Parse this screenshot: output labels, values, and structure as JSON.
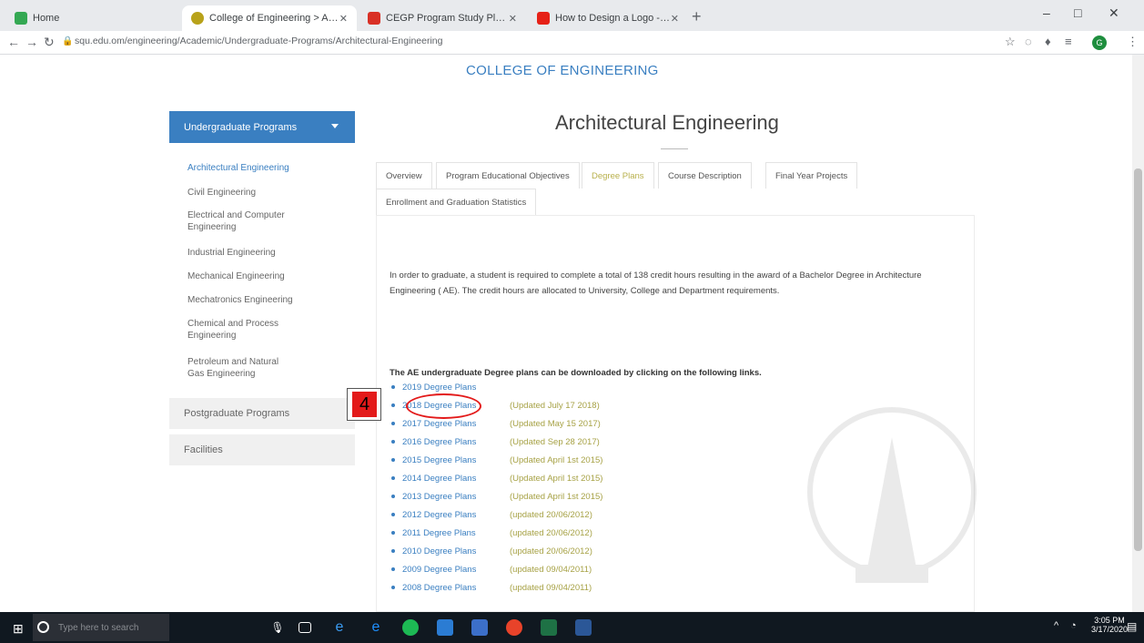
{
  "browser": {
    "tabs": [
      {
        "label": "Home",
        "color": "#34a853"
      },
      {
        "label": "College of Engineering > Academ",
        "color": "#b8a21a"
      },
      {
        "label": "CEGP Program Study Plans - ...",
        "color": "#d93025"
      },
      {
        "label": "How to Design a Logo - Full",
        "color": "#e62117"
      }
    ],
    "url": "squ.edu.om/engineering/Academic/Undergraduate-Programs/Architectural-Engineering",
    "new_tab": "+",
    "min": "–",
    "max": "□",
    "close": "✕"
  },
  "page": {
    "college": "COLLEGE OF ENGINEERING",
    "title": "Architectural Engineering"
  },
  "sidebar": {
    "header": "Undergraduate Programs",
    "items": [
      "Architectural Engineering",
      "Civil Engineering",
      "Electrical and Computer Engineering",
      "Industrial Engineering",
      "Mechanical Engineering",
      "Mechatronics Engineering",
      "Chemical and Process Engineering",
      "Petroleum and Natural Gas Engineering"
    ],
    "blocks": [
      "Postgraduate Programs",
      "Facilities"
    ]
  },
  "content_tabs": {
    "row1": [
      "Overview",
      "Program Educational Objectives",
      "Degree Plans",
      "Course Description",
      "Final Year Projects"
    ],
    "row2": [
      "Enrollment and Graduation Statistics"
    ],
    "selected": "Degree Plans"
  },
  "content": {
    "intro": "In order to graduate, a student is required to complete a total of 138 credit hours resulting in the award of a Bachelor Degree in Architecture Engineering ( AE). The credit hours are allocated to University, College and Department requirements.",
    "downloads_heading": "The AE undergraduate Degree plans can be downloaded by clicking on the following links."
  },
  "degree_plans": [
    {
      "label": "2019 Degree Plans",
      "updated": ""
    },
    {
      "label": "2018 Degree Plans",
      "updated": "(Updated July 17 2018)"
    },
    {
      "label": "2017 Degree Plans",
      "updated": "(Updated May 15 2017)"
    },
    {
      "label": "2016 Degree Plans",
      "updated": "(Updated Sep 28 2017)"
    },
    {
      "label": "2015 Degree Plans",
      "updated": "(Updated April 1st 2015)"
    },
    {
      "label": "2014 Degree Plans",
      "updated": "(Updated April 1st 2015)"
    },
    {
      "label": "2013 Degree Plans",
      "updated": "(Updated April 1st 2015)"
    },
    {
      "label": "2012 Degree Plans",
      "updated": "(updated 20/06/2012)"
    },
    {
      "label": "2011 Degree Plans",
      "updated": "(updated 20/06/2012)"
    },
    {
      "label": "2010 Degree Plans",
      "updated": "(updated 20/06/2012)"
    },
    {
      "label": "2009 Degree Plans",
      "updated": "(updated 09/04/2011)"
    },
    {
      "label": "2008 Degree Plans",
      "updated": "(updated 09/04/2011)"
    }
  ],
  "annotation": {
    "number": "4"
  },
  "taskbar": {
    "search_placeholder": "Type here to search",
    "time": "3:05 PM",
    "date": "3/17/2020"
  }
}
